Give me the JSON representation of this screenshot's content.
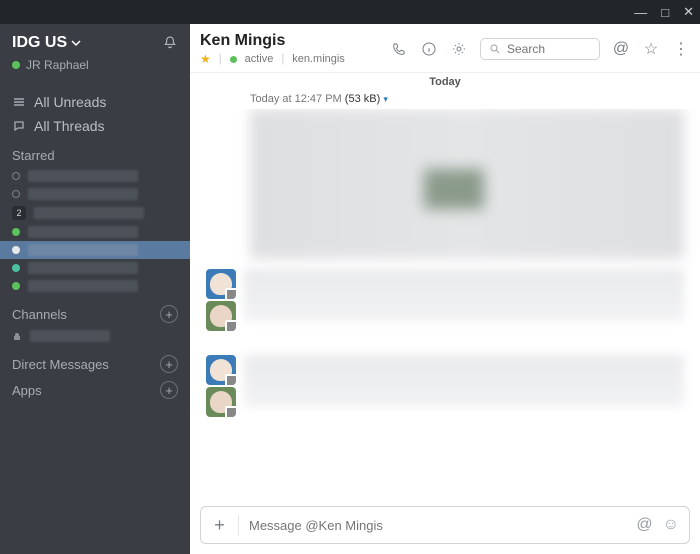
{
  "titlebar": {
    "min": "—",
    "max": "□",
    "close": "✕"
  },
  "workspace": {
    "name": "IDG US",
    "user": "JR Raphael"
  },
  "nav": {
    "unreads": "All Unreads",
    "threads": "All Threads"
  },
  "sections": {
    "starred": "Starred",
    "channels": "Channels",
    "dms": "Direct Messages",
    "apps": "Apps",
    "starred_badge": "2"
  },
  "header": {
    "name": "Ken Mingis",
    "status": "active",
    "username": "ken.mingis",
    "search_placeholder": "Search"
  },
  "timeline": {
    "date_label": "Today",
    "time_label": "Today at 12:47 PM",
    "file_size": "(53 kB)"
  },
  "composer": {
    "placeholder": "Message @Ken Mingis"
  }
}
